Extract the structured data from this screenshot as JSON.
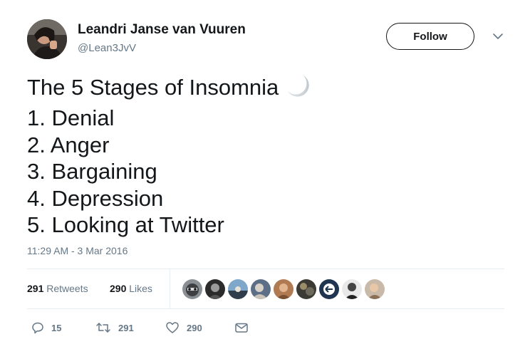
{
  "author": {
    "name": "Leandri Janse van Vuuren",
    "handle": "@Lean3JvV"
  },
  "follow_button": {
    "label": "Follow"
  },
  "menu": {
    "icon": "chevron-down-icon"
  },
  "tweet": {
    "lines": [
      "The 5 Stages of Insomnia",
      "1. Denial",
      "2. Anger",
      "3. Bargaining",
      "4. Depression",
      "5. Looking at Twitter"
    ],
    "emoji": "crescent-moon-emoji",
    "timestamp": "11:29 AM - 3 Mar 2016"
  },
  "stats": {
    "retweets": {
      "count": "291",
      "label": "Retweets"
    },
    "likes": {
      "count": "290",
      "label": "Likes"
    }
  },
  "likers_count_shown": 9,
  "actions": {
    "reply": {
      "icon": "reply-icon",
      "count": "15"
    },
    "retweet": {
      "icon": "retweet-icon",
      "count": "291"
    },
    "like": {
      "icon": "heart-icon",
      "count": "290"
    },
    "message": {
      "icon": "envelope-icon"
    }
  },
  "colors": {
    "text": "#14171a",
    "secondary": "#657786",
    "divider": "#e6ecf0"
  }
}
